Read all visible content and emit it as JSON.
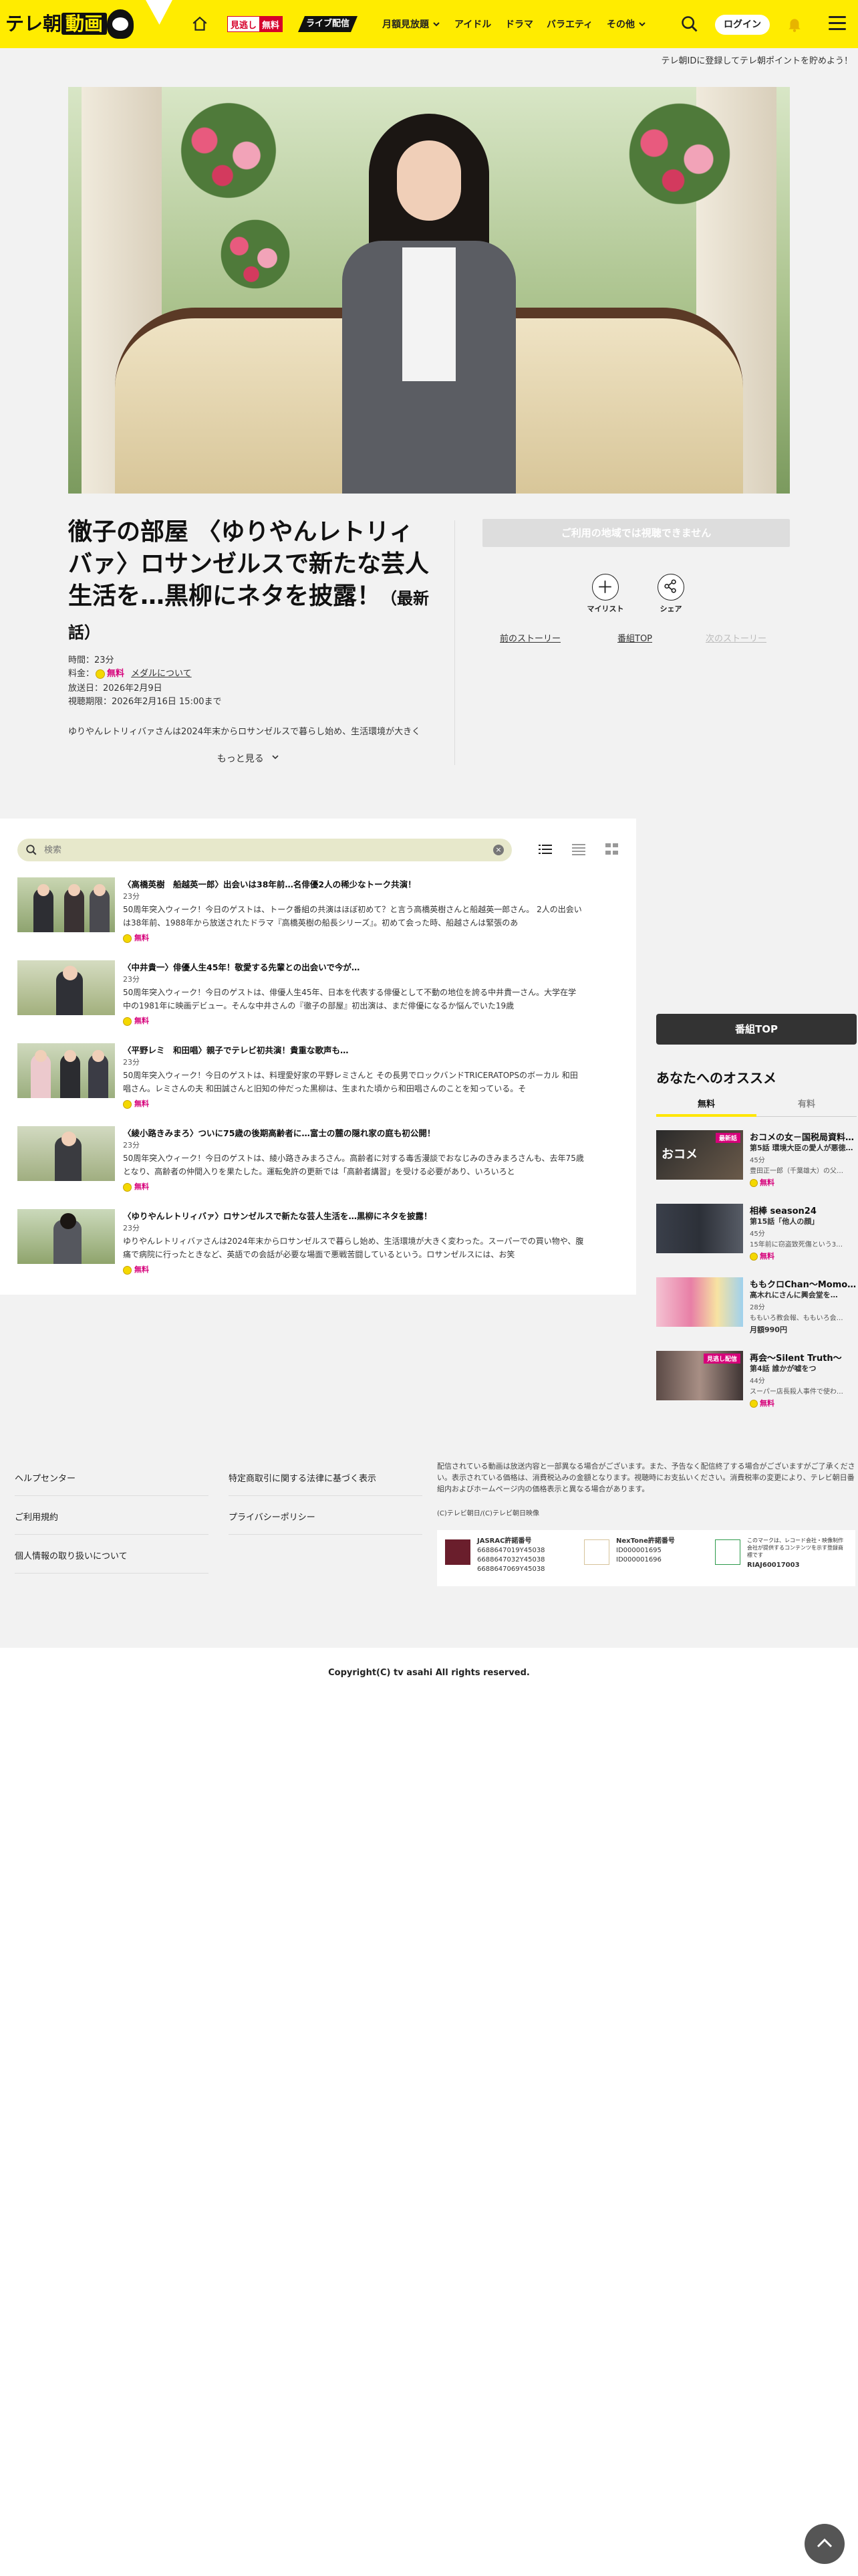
{
  "header": {
    "logo_text_a": "テレ朝",
    "logo_text_b": "動画",
    "badge_label_a": "見逃し",
    "badge_label_b": "無料",
    "live_label": "ライブ配信",
    "menu": [
      "月額見放題",
      "アイドル",
      "ドラマ",
      "バラエティ",
      "その他"
    ],
    "login_label": "ログイン"
  },
  "banner_text": "テレ朝IDに登録してテレ朝ポイントを貯めよう！",
  "episode": {
    "title": "徹子の部屋 〈ゆりやんレトリィバァ〉ロサンゼルスで新たな芸人生活を…黒柳にネタを披露！",
    "latest_label": "（最新話）",
    "duration": "時間：23分",
    "price_label": "料金：",
    "price_value": "無料",
    "medal_link": "メダルについて",
    "air_date": "放送日：2026年2月9日",
    "deadline": "視聴期限：2026年2月16日 15:00まで",
    "description": "ゆりやんレトリィバァさんは2024年末からロサンゼルスで暮らし始め、生活環境が大きく",
    "more_label": "もっと見る",
    "disabled_button": "ご利用の地域では視聴できません",
    "mylist_label": "マイリスト",
    "share_label": "シェア",
    "prev_story": "前のストーリー",
    "program_top": "番組TOP",
    "next_story": "次のストーリー"
  },
  "search": {
    "placeholder": "検索"
  },
  "list": [
    {
      "title": "〈高橋英樹　船越英一郎〉出会いは38年前…名俳優2人の稀少なトーク共演！",
      "duration": "23分",
      "text": "50周年突入ウィーク！今日のゲストは、トーク番組の共演はほぼ初めて？と言う高橋英樹さんと船越英一郎さん。 2人の出会いは38年前、1988年から放送されたドラマ『高橋英樹の船長シリーズ』。初めて会った時、船越さんは緊張のあ",
      "free": "無料"
    },
    {
      "title": "〈中井貴一〉俳優人生45年！敬愛する先輩との出会いで今が…",
      "duration": "23分",
      "text": "50周年突入ウィーク！今日のゲストは、俳優人生45年、日本を代表する俳優として不動の地位を誇る中井貴一さん。大学在学中の1981年に映画デビュー。そんな中井さんの『徹子の部屋』初出演は、まだ俳優になるか悩んでいた19歳",
      "free": "無料"
    },
    {
      "title": "〈平野レミ　和田唱〉親子でテレビ初共演！貴重な歌声も…",
      "duration": "23分",
      "text": "50周年突入ウィーク！今日のゲストは、料理愛好家の平野レミさんと その長男でロックバンドTRICERATOPSのボーカル 和田唱さん。レミさんの夫 和田誠さんと旧知の仲だった黒柳は、生まれた頃から和田唱さんのことを知っている。そ",
      "free": "無料"
    },
    {
      "title": "〈綾小路きみまろ〉ついに75歳の後期高齢者に…富士の麓の隠れ家の庭も初公開！",
      "duration": "23分",
      "text": "50周年突入ウィーク！今日のゲストは、綾小路きみまろさん。高齢者に対する毒舌漫談でおなじみのきみまろさんも、去年75歳となり、高齢者の仲間入りを果たした。運転免許の更新では「高齢者講習」を受ける必要があり、いろいろと",
      "free": "無料"
    },
    {
      "title": "〈ゆりやんレトリィバァ〉ロサンゼルスで新たな芸人生活を…黒柳にネタを披露！",
      "duration": "23分",
      "text": "ゆりやんレトリィバァさんは2024年末からロサンゼルスで暮らし始め、生活環境が大きく変わった。スーパーでの買い物や、腹痛で病院に行ったときなど、英語での会話が必要な場面で悪戦苦闘しているという。ロサンゼルスには、お笑",
      "free": "無料"
    }
  ],
  "side": {
    "program_top": "番組TOP",
    "rec_title": "あなたへのオススメ",
    "tab_free": "無料",
    "tab_paid": "有料",
    "items": [
      {
        "name": "おコメの女－国税局資料…",
        "sub": "第5話 環境大臣の愛人が悪徳…",
        "duration": "45分",
        "desc": "豊田正一郎（千葉雄大）の父…",
        "price": "無料",
        "tag": "最新話"
      },
      {
        "name": "相棒 season24",
        "sub": "第15話「他人の顔」",
        "duration": "45分",
        "desc": "15年前に窃盗致死傷という3…",
        "price": "無料",
        "tag": ""
      },
      {
        "name": "ももクロChan～Momo…",
        "sub": "高木れにさんに興会堂を…",
        "duration": "28分",
        "desc": "ももいろ教会報、ももいろ会…",
        "price": "月額990円",
        "tag": ""
      },
      {
        "name": "再会～Silent Truth～",
        "sub": "第4話 誰かが嘘をつ",
        "duration": "44分",
        "desc": "スーパー店長殺人事件で使わ…",
        "price": "無料",
        "tag": "見逃し配信"
      }
    ]
  },
  "footer": {
    "links_left": [
      "ヘルプセンター",
      "ご利用規約",
      "個人情報の取り扱いについて"
    ],
    "links_right": [
      "特定商取引に関する法律に基づく表示",
      "プライバシーポリシー"
    ],
    "note": "配信されている動画は放送内容と一部異なる場合がございます。また、予告なく配信終了する場合がございますがご了承ください。表示されている価格は、消費税込みの金額となります。視聴時にお支払いください。消費税率の変更により、テレビ朝日番組内およびホームページ内の価格表示と異なる場合があります。",
    "brand": "(C)テレビ朝日/(C)テレビ朝日映像",
    "licenses": [
      {
        "title": "JASRAC許諾番号",
        "lines": [
          "6688647019Y45038",
          "6688647032Y45038",
          "6688647069Y45038"
        ]
      },
      {
        "title": "NexTone許諾番号",
        "lines": [
          "ID000001695",
          "ID000001696"
        ]
      },
      {
        "title": "RIAJ60017003",
        "lines": [
          "このマークは、レコード会社・映像制作会社が提供するコンテンツを示す登録商標です"
        ]
      }
    ],
    "copyright": "Copyright(C) tv asahi All rights reserved."
  }
}
